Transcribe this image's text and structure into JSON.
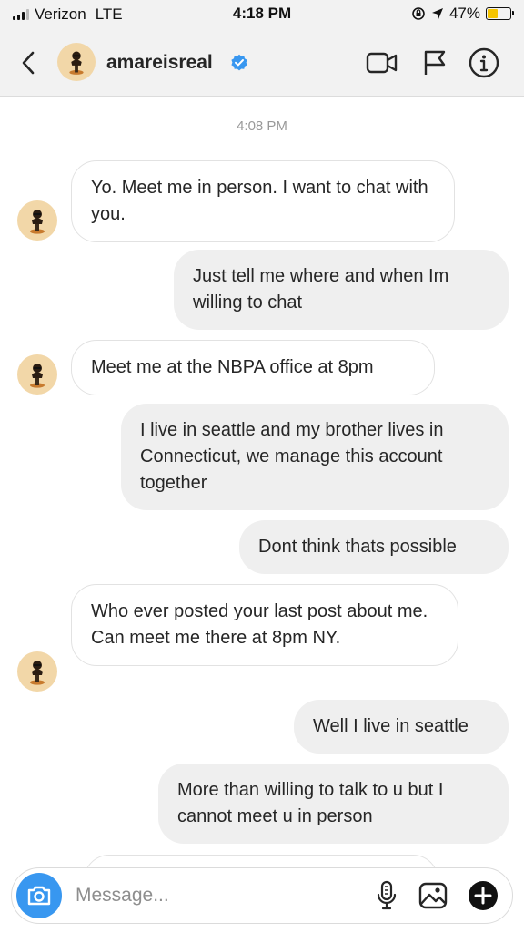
{
  "status_bar": {
    "carrier": "Verizon",
    "network": "LTE",
    "time": "4:18 PM",
    "battery": "47%",
    "battery_level": 0.47
  },
  "header": {
    "username": "amareisreal",
    "verified": true
  },
  "chat": {
    "timestamp": "4:08 PM",
    "messages": [
      {
        "from": "them",
        "text": "Yo. Meet me in person. I want to chat with you."
      },
      {
        "from": "me",
        "text": "Just tell me where and when Im willing to chat"
      },
      {
        "from": "them",
        "text": "Meet me at the NBPA office at 8pm"
      },
      {
        "from": "me",
        "text": "I live in seattle and my brother lives in Connecticut, we manage this account together"
      },
      {
        "from": "me",
        "text": "Dont think thats possible"
      },
      {
        "from": "them",
        "text": "Who ever posted your last post about me. Can meet me there at 8pm NY."
      },
      {
        "from": "me",
        "text": "Well I live in seattle"
      },
      {
        "from": "me",
        "text": "More than willing to talk to u but I cannot meet u in person"
      }
    ]
  },
  "composer": {
    "placeholder": "Message..."
  },
  "colors": {
    "accent": "#3897f0",
    "verified": "#3897f0",
    "battery": "#f5c400",
    "out_bubble": "#efefef"
  },
  "icons": [
    "back-icon",
    "video-call-icon",
    "flag-icon",
    "info-icon",
    "camera-icon",
    "microphone-icon",
    "gallery-icon",
    "add-icon",
    "verified-badge-icon"
  ]
}
